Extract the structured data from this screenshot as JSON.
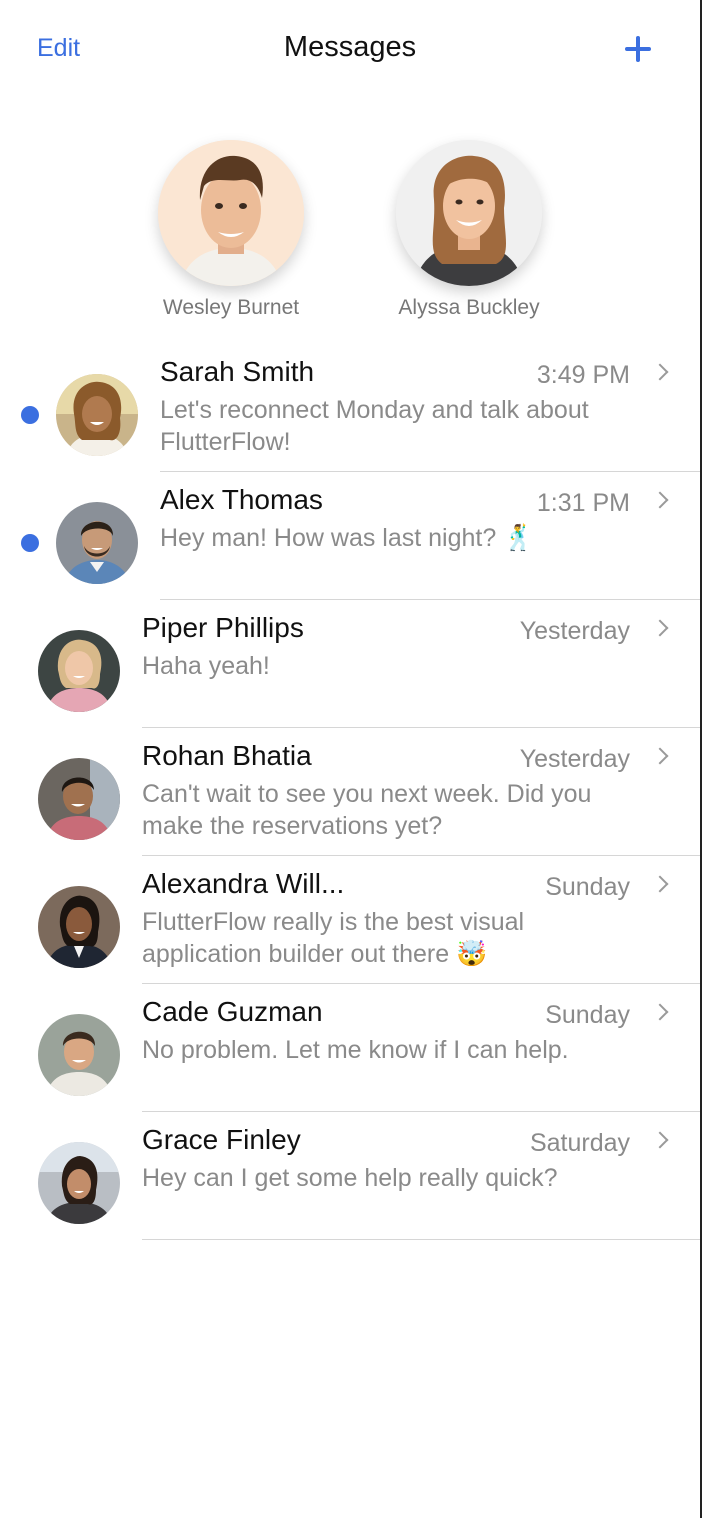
{
  "header": {
    "edit_label": "Edit",
    "title": "Messages",
    "new_message_icon": "plus-icon",
    "accent_color": "#3b6fe0"
  },
  "pinned": [
    {
      "name": "Wesley Burnet"
    },
    {
      "name": "Alyssa Buckley"
    }
  ],
  "messages": [
    {
      "name": "Sarah Smith",
      "time": "3:49 PM",
      "preview": "Let's reconnect Monday and talk about FlutterFlow!",
      "unread": true
    },
    {
      "name": "Alex Thomas",
      "time": "1:31 PM",
      "preview": "Hey man! How was last night? 🕺",
      "unread": true
    },
    {
      "name": "Piper Phillips",
      "time": "Yesterday",
      "preview": "Haha yeah!",
      "unread": false
    },
    {
      "name": "Rohan Bhatia",
      "time": "Yesterday",
      "preview": "Can't wait to see you next week. Did you make the reservations yet?",
      "unread": false
    },
    {
      "name": "Alexandra Will...",
      "time": "Sunday",
      "preview": "FlutterFlow really is the best visual application builder out there 🤯",
      "unread": false
    },
    {
      "name": "Cade Guzman",
      "time": "Sunday",
      "preview": "No problem. Let me know if I can help.",
      "unread": false
    },
    {
      "name": "Grace Finley",
      "time": "Saturday",
      "preview": "Hey can I get some help really quick?",
      "unread": false
    }
  ]
}
